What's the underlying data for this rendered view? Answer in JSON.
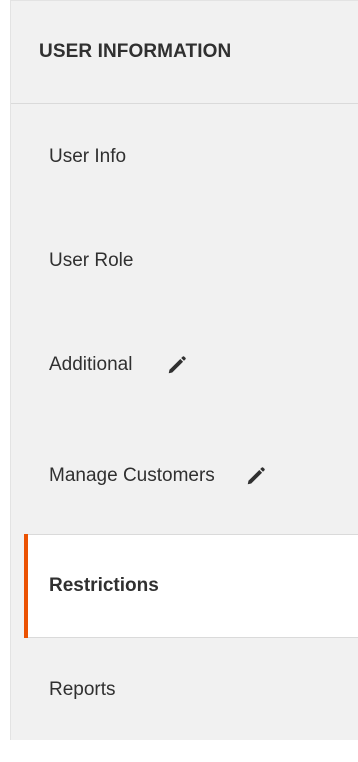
{
  "panel": {
    "title": "USER INFORMATION"
  },
  "nav": {
    "items": [
      {
        "label": "User Info",
        "has_edit_icon": false,
        "active": false
      },
      {
        "label": "User Role",
        "has_edit_icon": false,
        "active": false
      },
      {
        "label": "Additional",
        "has_edit_icon": true,
        "active": false
      },
      {
        "label": "Manage Customers",
        "has_edit_icon": true,
        "active": false
      },
      {
        "label": "Restrictions",
        "has_edit_icon": false,
        "active": true
      },
      {
        "label": "Reports",
        "has_edit_icon": false,
        "active": false
      }
    ]
  },
  "colors": {
    "active_accent": "#eb5202",
    "panel_background": "#f1f1f1",
    "active_background": "#ffffff",
    "text": "#303030"
  },
  "icons": {
    "edit": "pencil-icon"
  }
}
